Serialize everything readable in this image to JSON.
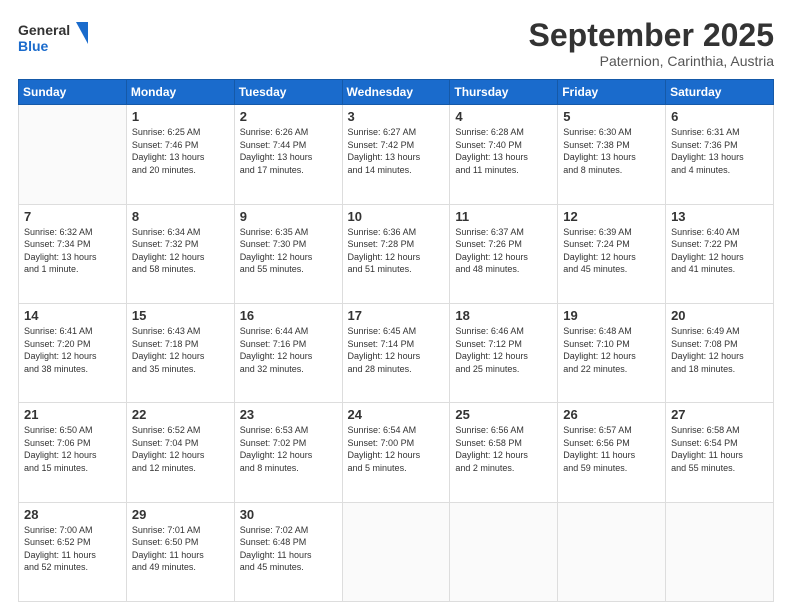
{
  "header": {
    "logo_line1": "General",
    "logo_line2": "Blue",
    "month": "September 2025",
    "location": "Paternion, Carinthia, Austria"
  },
  "weekdays": [
    "Sunday",
    "Monday",
    "Tuesday",
    "Wednesday",
    "Thursday",
    "Friday",
    "Saturday"
  ],
  "weeks": [
    [
      {
        "day": "",
        "info": ""
      },
      {
        "day": "1",
        "info": "Sunrise: 6:25 AM\nSunset: 7:46 PM\nDaylight: 13 hours\nand 20 minutes."
      },
      {
        "day": "2",
        "info": "Sunrise: 6:26 AM\nSunset: 7:44 PM\nDaylight: 13 hours\nand 17 minutes."
      },
      {
        "day": "3",
        "info": "Sunrise: 6:27 AM\nSunset: 7:42 PM\nDaylight: 13 hours\nand 14 minutes."
      },
      {
        "day": "4",
        "info": "Sunrise: 6:28 AM\nSunset: 7:40 PM\nDaylight: 13 hours\nand 11 minutes."
      },
      {
        "day": "5",
        "info": "Sunrise: 6:30 AM\nSunset: 7:38 PM\nDaylight: 13 hours\nand 8 minutes."
      },
      {
        "day": "6",
        "info": "Sunrise: 6:31 AM\nSunset: 7:36 PM\nDaylight: 13 hours\nand 4 minutes."
      }
    ],
    [
      {
        "day": "7",
        "info": "Sunrise: 6:32 AM\nSunset: 7:34 PM\nDaylight: 13 hours\nand 1 minute."
      },
      {
        "day": "8",
        "info": "Sunrise: 6:34 AM\nSunset: 7:32 PM\nDaylight: 12 hours\nand 58 minutes."
      },
      {
        "day": "9",
        "info": "Sunrise: 6:35 AM\nSunset: 7:30 PM\nDaylight: 12 hours\nand 55 minutes."
      },
      {
        "day": "10",
        "info": "Sunrise: 6:36 AM\nSunset: 7:28 PM\nDaylight: 12 hours\nand 51 minutes."
      },
      {
        "day": "11",
        "info": "Sunrise: 6:37 AM\nSunset: 7:26 PM\nDaylight: 12 hours\nand 48 minutes."
      },
      {
        "day": "12",
        "info": "Sunrise: 6:39 AM\nSunset: 7:24 PM\nDaylight: 12 hours\nand 45 minutes."
      },
      {
        "day": "13",
        "info": "Sunrise: 6:40 AM\nSunset: 7:22 PM\nDaylight: 12 hours\nand 41 minutes."
      }
    ],
    [
      {
        "day": "14",
        "info": "Sunrise: 6:41 AM\nSunset: 7:20 PM\nDaylight: 12 hours\nand 38 minutes."
      },
      {
        "day": "15",
        "info": "Sunrise: 6:43 AM\nSunset: 7:18 PM\nDaylight: 12 hours\nand 35 minutes."
      },
      {
        "day": "16",
        "info": "Sunrise: 6:44 AM\nSunset: 7:16 PM\nDaylight: 12 hours\nand 32 minutes."
      },
      {
        "day": "17",
        "info": "Sunrise: 6:45 AM\nSunset: 7:14 PM\nDaylight: 12 hours\nand 28 minutes."
      },
      {
        "day": "18",
        "info": "Sunrise: 6:46 AM\nSunset: 7:12 PM\nDaylight: 12 hours\nand 25 minutes."
      },
      {
        "day": "19",
        "info": "Sunrise: 6:48 AM\nSunset: 7:10 PM\nDaylight: 12 hours\nand 22 minutes."
      },
      {
        "day": "20",
        "info": "Sunrise: 6:49 AM\nSunset: 7:08 PM\nDaylight: 12 hours\nand 18 minutes."
      }
    ],
    [
      {
        "day": "21",
        "info": "Sunrise: 6:50 AM\nSunset: 7:06 PM\nDaylight: 12 hours\nand 15 minutes."
      },
      {
        "day": "22",
        "info": "Sunrise: 6:52 AM\nSunset: 7:04 PM\nDaylight: 12 hours\nand 12 minutes."
      },
      {
        "day": "23",
        "info": "Sunrise: 6:53 AM\nSunset: 7:02 PM\nDaylight: 12 hours\nand 8 minutes."
      },
      {
        "day": "24",
        "info": "Sunrise: 6:54 AM\nSunset: 7:00 PM\nDaylight: 12 hours\nand 5 minutes."
      },
      {
        "day": "25",
        "info": "Sunrise: 6:56 AM\nSunset: 6:58 PM\nDaylight: 12 hours\nand 2 minutes."
      },
      {
        "day": "26",
        "info": "Sunrise: 6:57 AM\nSunset: 6:56 PM\nDaylight: 11 hours\nand 59 minutes."
      },
      {
        "day": "27",
        "info": "Sunrise: 6:58 AM\nSunset: 6:54 PM\nDaylight: 11 hours\nand 55 minutes."
      }
    ],
    [
      {
        "day": "28",
        "info": "Sunrise: 7:00 AM\nSunset: 6:52 PM\nDaylight: 11 hours\nand 52 minutes."
      },
      {
        "day": "29",
        "info": "Sunrise: 7:01 AM\nSunset: 6:50 PM\nDaylight: 11 hours\nand 49 minutes."
      },
      {
        "day": "30",
        "info": "Sunrise: 7:02 AM\nSunset: 6:48 PM\nDaylight: 11 hours\nand 45 minutes."
      },
      {
        "day": "",
        "info": ""
      },
      {
        "day": "",
        "info": ""
      },
      {
        "day": "",
        "info": ""
      },
      {
        "day": "",
        "info": ""
      }
    ]
  ]
}
